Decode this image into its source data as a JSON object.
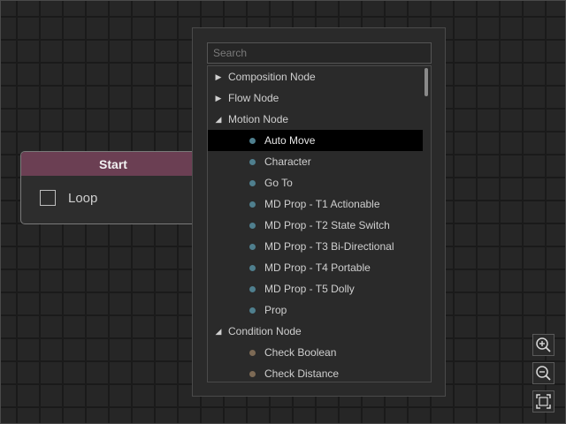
{
  "start_node": {
    "title": "Start",
    "loop_label": "Loop",
    "loop_checked": false,
    "header_color": "#6b3f53"
  },
  "popup": {
    "search_placeholder": "Search",
    "categories": [
      {
        "label": "Composition Node",
        "expanded": false,
        "items": []
      },
      {
        "label": "Flow Node",
        "expanded": false,
        "items": []
      },
      {
        "label": "Motion Node",
        "expanded": true,
        "dot_color": "#4f7f8e",
        "items": [
          {
            "label": "Auto Move",
            "selected": true
          },
          {
            "label": "Character"
          },
          {
            "label": "Go To"
          },
          {
            "label": "MD Prop - T1 Actionable"
          },
          {
            "label": "MD Prop - T2 State Switch"
          },
          {
            "label": "MD Prop - T3 Bi-Directional"
          },
          {
            "label": "MD Prop - T4 Portable"
          },
          {
            "label": "MD Prop - T5 Dolly"
          },
          {
            "label": "Prop"
          }
        ]
      },
      {
        "label": "Condition Node",
        "expanded": true,
        "dot_color": "#7d6a55",
        "items": [
          {
            "label": "Check Boolean"
          },
          {
            "label": "Check Distance"
          }
        ]
      }
    ]
  },
  "zoom_controls": [
    {
      "name": "zoom-in",
      "icon": "zoom-in-icon"
    },
    {
      "name": "zoom-out",
      "icon": "zoom-out-icon"
    },
    {
      "name": "fit-view",
      "icon": "fit-view-icon"
    }
  ]
}
